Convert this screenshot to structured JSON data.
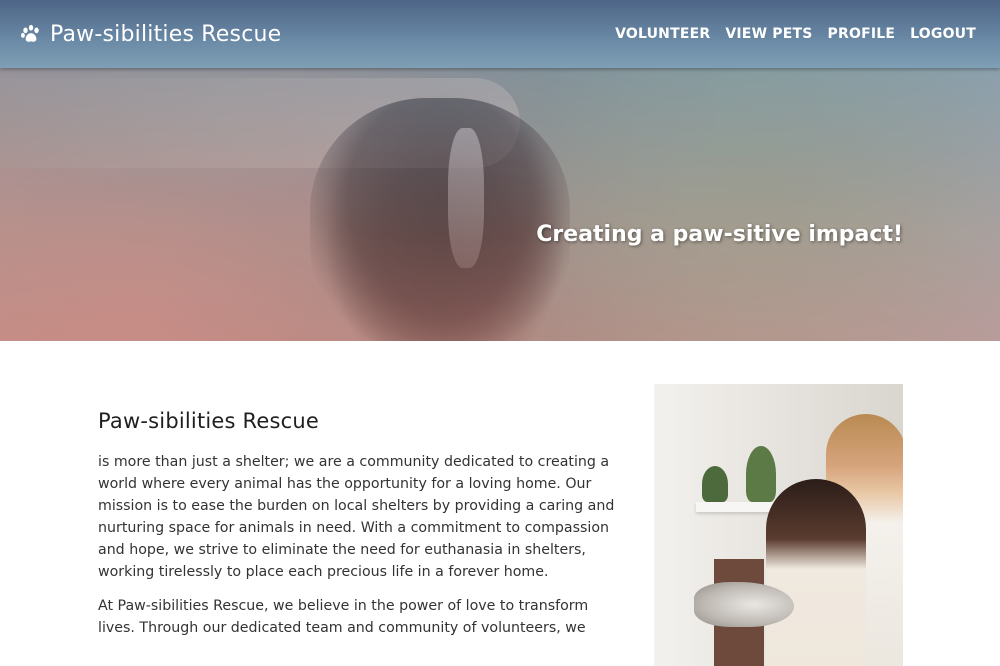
{
  "header": {
    "brand": "Paw-sibilities Rescue",
    "brand_icon": "paw-icon",
    "nav": [
      {
        "label": "VOLUNTEER"
      },
      {
        "label": "VIEW PETS"
      },
      {
        "label": "PROFILE"
      },
      {
        "label": "LOGOUT"
      }
    ]
  },
  "hero": {
    "tagline": "Creating a paw-sitive impact!"
  },
  "about": {
    "title": "Paw-sibilities Rescue",
    "paragraphs": [
      "is more than just a shelter; we are a community dedicated to creating a world where every animal has the opportunity for a loving home. Our mission is to ease the burden on local shelters by providing a caring and nurturing space for animals in need. With a commitment to compassion and hope, we strive to eliminate the need for euthanasia in shelters, working tirelessly to place each precious life in a forever home.",
      "At Paw-sibilities Rescue, we believe in the power of love to transform lives. Through our dedicated team and community of volunteers, we"
    ]
  },
  "colors": {
    "header_bg": "#5d7896",
    "text": "#333333"
  }
}
